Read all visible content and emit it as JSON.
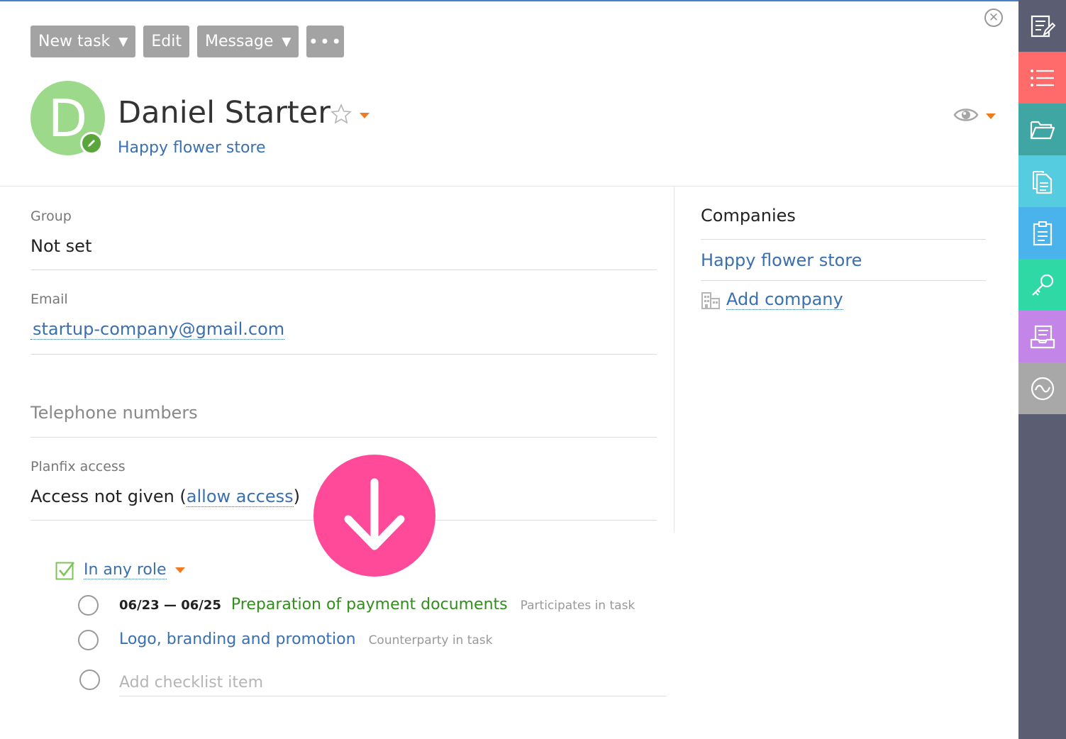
{
  "toolbar": {
    "new_task": "New task",
    "edit": "Edit",
    "message": "Message",
    "more": "•••",
    "dropdown_glyph": "▼"
  },
  "close_glyph": "✕",
  "contact": {
    "initial": "D",
    "name": "Daniel Starter",
    "company": "Happy flower store"
  },
  "fields": {
    "group_label": "Group",
    "group_value": "Not set",
    "email_label": "Email",
    "email_value": "startup-company@gmail.com",
    "phones_label": "Telephone numbers",
    "access_label": "Planfix access",
    "access_prefix": "Access not given (",
    "access_link": "allow access",
    "access_suffix": ")"
  },
  "companies": {
    "title": "Companies",
    "items": [
      "Happy flower store"
    ],
    "add_label": "Add company"
  },
  "tasks": {
    "role_filter": "In any role",
    "items": [
      {
        "date": "06/23 — 06/25",
        "name": "Preparation of payment documents",
        "role": "Participates in task",
        "color": "#2f8f1a"
      },
      {
        "date": "",
        "name": "Logo, branding and promotion",
        "role": "Counterparty in task",
        "color": "#3a6fb0"
      }
    ],
    "add_placeholder": "Add checklist item"
  },
  "colors": {
    "avatar": "#9dd98a",
    "accent_link": "#3a6fb0",
    "orange": "#f07a1d",
    "fab": "#ff4a9a",
    "sidebar": "#5b5d73"
  },
  "sidebar": [
    {
      "icon": "edit-note-icon",
      "color": "#5b5d73"
    },
    {
      "icon": "list-icon",
      "color": "#ff6b6b"
    },
    {
      "icon": "folder-icon",
      "color": "#3fa6a4"
    },
    {
      "icon": "documents-icon",
      "color": "#56cce0"
    },
    {
      "icon": "clipboard-icon",
      "color": "#4ab3ec"
    },
    {
      "icon": "key-icon",
      "color": "#2ed9a6"
    },
    {
      "icon": "inbox-icon",
      "color": "#c385e8"
    },
    {
      "icon": "activity-icon",
      "color": "#a8a8a8"
    }
  ]
}
